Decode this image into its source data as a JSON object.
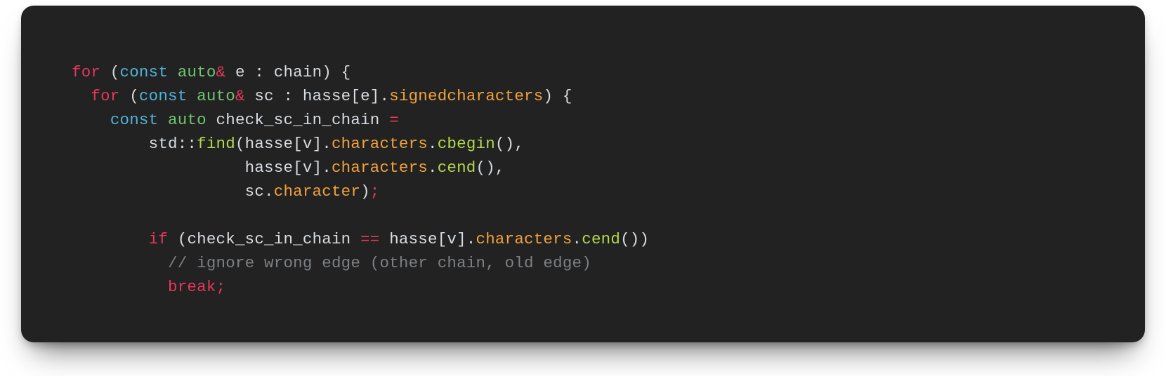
{
  "code": {
    "tokens": {
      "for": "for",
      "if": "if",
      "break": "break",
      "const": "const",
      "auto": "auto",
      "amp": "&",
      "eqeq": "==",
      "semi": ";",
      "e": "e",
      "sc": "sc",
      "v": "v",
      "chain": "chain",
      "hasse": "hasse",
      "check_sc_in_chain": "check_sc_in_chain",
      "std": "std",
      "find": "find",
      "cbegin": "cbegin",
      "cend": "cend",
      "signedcharacters": "signedcharacters",
      "characters": "characters",
      "character": "character",
      "comment": "// ignore wrong edge (other chain, old edge)"
    }
  },
  "colors": {
    "background": "#222222",
    "keyword_red": "#e6375b",
    "keyword_cyan": "#4fb3d9",
    "type_green": "#6fc66f",
    "property_orange": "#f2a23c",
    "function_lime": "#b6d94c",
    "comment_gray": "#7d8084",
    "default_text": "#d9dde1"
  }
}
